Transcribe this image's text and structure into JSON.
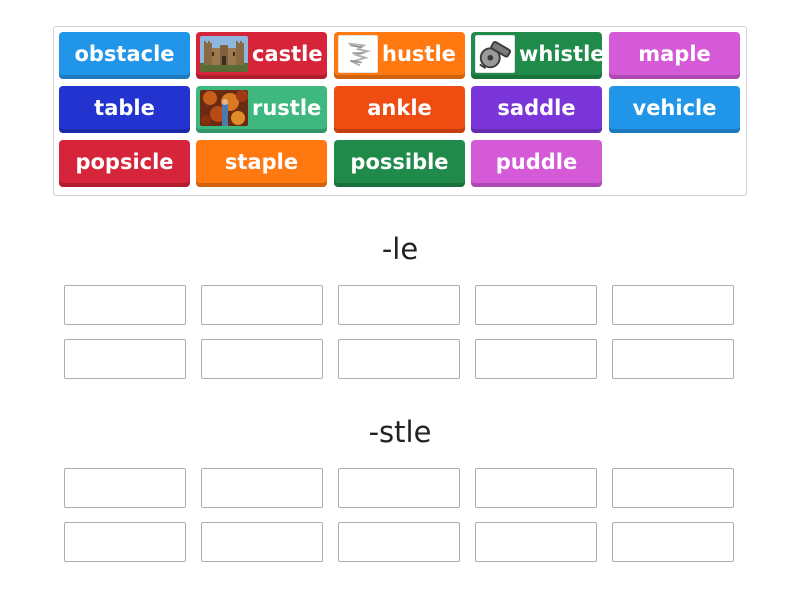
{
  "tiles": [
    {
      "label": "obstacle",
      "color": "#2196e8",
      "image": null
    },
    {
      "label": "castle",
      "color": "#d6243a",
      "image": "castle-photo"
    },
    {
      "label": "hustle",
      "color": "#ff7810",
      "image": "hustle-icon"
    },
    {
      "label": "whistle",
      "color": "#1f8a4a",
      "image": "whistle-icon"
    },
    {
      "label": "maple",
      "color": "#d55ad8",
      "image": null
    },
    {
      "label": "table",
      "color": "#2233cf",
      "image": null
    },
    {
      "label": "rustle",
      "color": "#3fb87f",
      "image": "rustling-leaves-photo"
    },
    {
      "label": "ankle",
      "color": "#ef4c12",
      "image": null
    },
    {
      "label": "saddle",
      "color": "#7a35d9",
      "image": null
    },
    {
      "label": "vehicle",
      "color": "#2196e8",
      "image": null
    },
    {
      "label": "popsicle",
      "color": "#d6243a",
      "image": null
    },
    {
      "label": "staple",
      "color": "#ff7810",
      "image": null
    },
    {
      "label": "possible",
      "color": "#1f8a4a",
      "image": null
    },
    {
      "label": "puddle",
      "color": "#d55ad8",
      "image": null
    }
  ],
  "groups": [
    {
      "heading": "-le",
      "slot_count": 10
    },
    {
      "heading": "-stle",
      "slot_count": 10
    }
  ]
}
